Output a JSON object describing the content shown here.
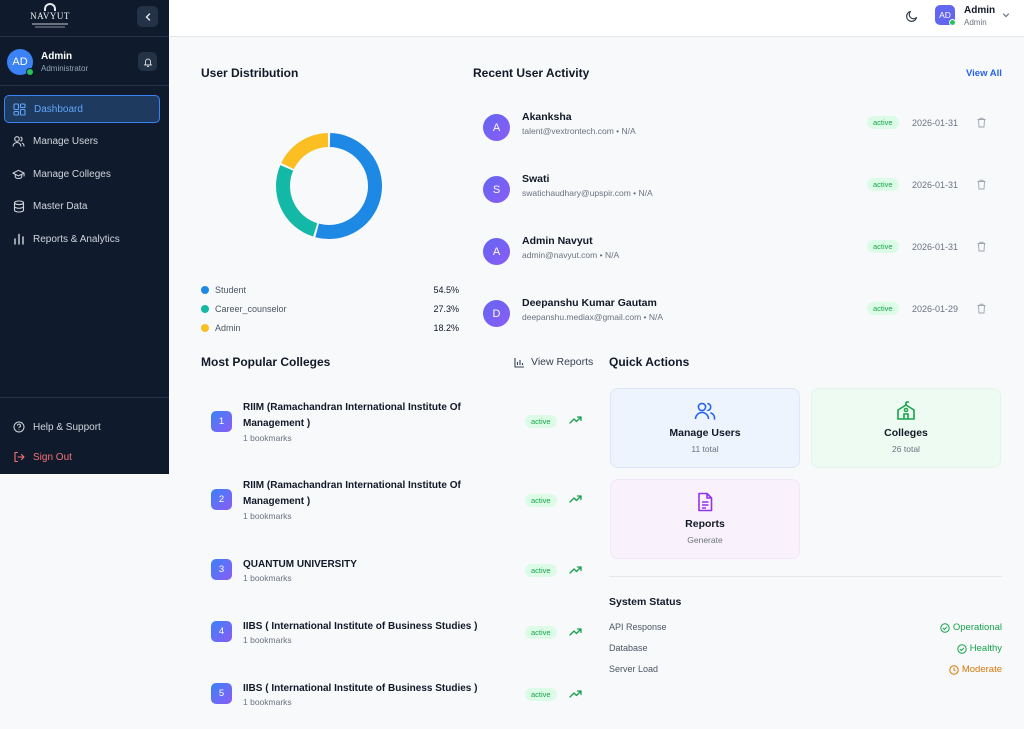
{
  "app": {
    "logo_text": "NAVYUT"
  },
  "sidebar": {
    "profile_name": "Admin",
    "profile_role": "Administrator",
    "avatar_initials": "AD",
    "nav": [
      {
        "label": "Dashboard",
        "icon": "dashboard-icon",
        "active": true
      },
      {
        "label": "Manage Users",
        "icon": "users-icon"
      },
      {
        "label": "Manage Colleges",
        "icon": "graduation-cap-icon"
      },
      {
        "label": "Master Data",
        "icon": "database-icon"
      },
      {
        "label": "Reports & Analytics",
        "icon": "bar-chart-icon"
      }
    ],
    "help": "Help & Support",
    "signout": "Sign Out"
  },
  "topbar": {
    "avatar_initials": "AD",
    "user_name": "Admin",
    "user_role": "Admin"
  },
  "distribution": {
    "title": "User Distribution",
    "legend": [
      {
        "label": "Student",
        "pct": "54.5%",
        "color": "#1e88e5"
      },
      {
        "label": "Career_counselor",
        "pct": "27.3%",
        "color": "#14b8a6"
      },
      {
        "label": "Admin",
        "pct": "18.2%",
        "color": "#fbbf24"
      }
    ]
  },
  "chart_data": {
    "type": "pie",
    "categories": [
      "Student",
      "Career_counselor",
      "Admin"
    ],
    "values": [
      54.5,
      27.3,
      18.2
    ],
    "colors": [
      "#1e88e5",
      "#14b8a6",
      "#fbbf24"
    ],
    "donut": true
  },
  "activity": {
    "title": "Recent User Activity",
    "view_all": "View All",
    "rows": [
      {
        "initial": "A",
        "name": "Akanksha",
        "sub": "talent@vextrontech.com • N/A",
        "status": "active",
        "date": "2026-01-31"
      },
      {
        "initial": "S",
        "name": "Swati",
        "sub": "swatichaudhary@upspir.com • N/A",
        "status": "active",
        "date": "2026-01-31"
      },
      {
        "initial": "A",
        "name": "Admin Navyut",
        "sub": "admin@navyut.com • N/A",
        "status": "active",
        "date": "2026-01-31"
      },
      {
        "initial": "D",
        "name": "Deepanshu Kumar Gautam",
        "sub": "deepanshu.mediax@gmail.com • N/A",
        "status": "active",
        "date": "2026-01-29"
      }
    ]
  },
  "colleges": {
    "title": "Most Popular Colleges",
    "view_reports": "View Reports",
    "rows": [
      {
        "rank": "1",
        "name": "RIIM (Ramachandran International Institute Of Management )",
        "sub": "1 bookmarks",
        "status": "active"
      },
      {
        "rank": "2",
        "name": "RIIM (Ramachandran International Institute Of Management )",
        "sub": "1 bookmarks",
        "status": "active"
      },
      {
        "rank": "3",
        "name": "QUANTUM UNIVERSITY",
        "sub": "1 bookmarks",
        "status": "active"
      },
      {
        "rank": "4",
        "name": "IIBS ( International Institute of Business Studies )",
        "sub": "1 bookmarks",
        "status": "active"
      },
      {
        "rank": "5",
        "name": "IIBS ( International Institute of Business Studies )",
        "sub": "1 bookmarks",
        "status": "active"
      }
    ]
  },
  "quick_actions": {
    "title": "Quick Actions",
    "cards": [
      {
        "title": "Manage Users",
        "sub": "11 total",
        "icon": "users-icon",
        "color": "#2563eb"
      },
      {
        "title": "Colleges",
        "sub": "26 total",
        "icon": "school-icon",
        "color": "#16a34a"
      },
      {
        "title": "Reports",
        "sub": "Generate",
        "icon": "file-text-icon",
        "color": "#9333ea"
      }
    ]
  },
  "system_status": {
    "title": "System Status",
    "rows": [
      {
        "label": "API Response",
        "value": "Operational",
        "color": "#16a34a",
        "icon": "check-circle-icon"
      },
      {
        "label": "Database",
        "value": "Healthy",
        "color": "#16a34a",
        "icon": "check-circle-icon"
      },
      {
        "label": "Server Load",
        "value": "Moderate",
        "color": "#d97706",
        "icon": "clock-icon"
      }
    ]
  }
}
